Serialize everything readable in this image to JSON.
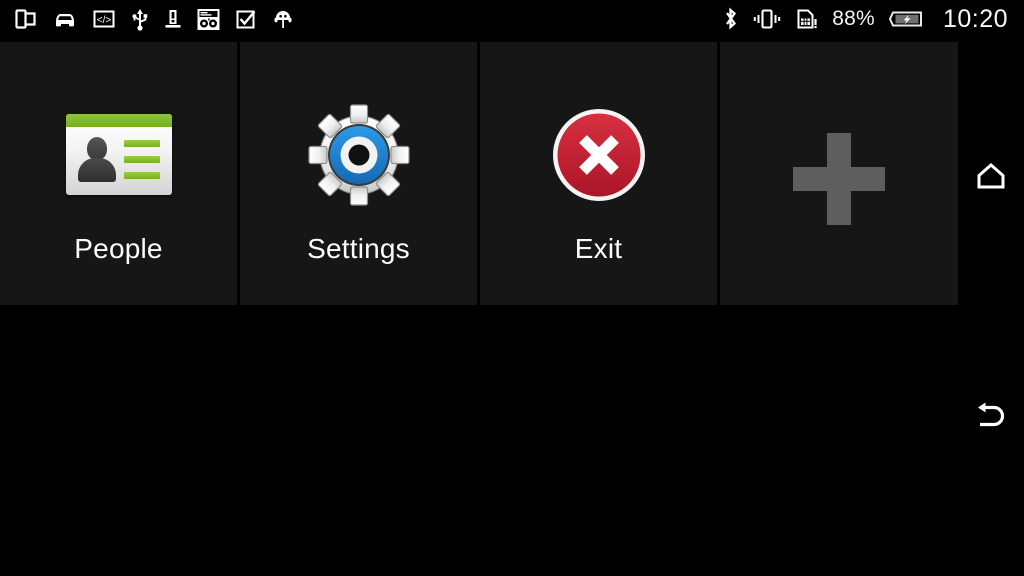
{
  "status_bar": {
    "left_icons": [
      {
        "name": "split-screen-icon",
        "label": "Split screen"
      },
      {
        "name": "car-mode-icon",
        "label": "Car mode"
      },
      {
        "name": "developer-code-icon",
        "label": "Developer options"
      },
      {
        "name": "usb-icon",
        "label": "USB connected"
      },
      {
        "name": "warning-exclamation-icon",
        "label": "Alert"
      },
      {
        "name": "htc-boombox-icon",
        "label": "HTC media"
      },
      {
        "name": "checkbox-checked-icon",
        "label": "Task complete"
      },
      {
        "name": "android-robot-icon",
        "label": "Android"
      }
    ],
    "right_icons": [
      {
        "name": "bluetooth-icon",
        "label": "Bluetooth"
      },
      {
        "name": "vibrate-icon",
        "label": "Vibrate mode"
      },
      {
        "name": "sim-card-alert-icon",
        "label": "No SIM card"
      }
    ],
    "battery_percent": "88%",
    "battery_icon": "battery-charging-icon",
    "clock": "10:20"
  },
  "panels": [
    {
      "label": "People",
      "icon": "contact-card-icon",
      "accent_color": "#8cc63f"
    },
    {
      "label": "Settings",
      "icon": "gear-icon",
      "accent_color": "#1e88d8"
    },
    {
      "label": "Exit",
      "icon": "close-circle-icon",
      "accent_color": "#c62334"
    },
    {
      "label": "",
      "icon": "plus-icon",
      "accent_color": "#5e5e5e"
    }
  ],
  "nav_bar": {
    "home_label": "Home",
    "back_label": "Back"
  },
  "theme": {
    "background": "#000000",
    "panel_background": "#161616",
    "text_color": "#fbfbfb"
  }
}
